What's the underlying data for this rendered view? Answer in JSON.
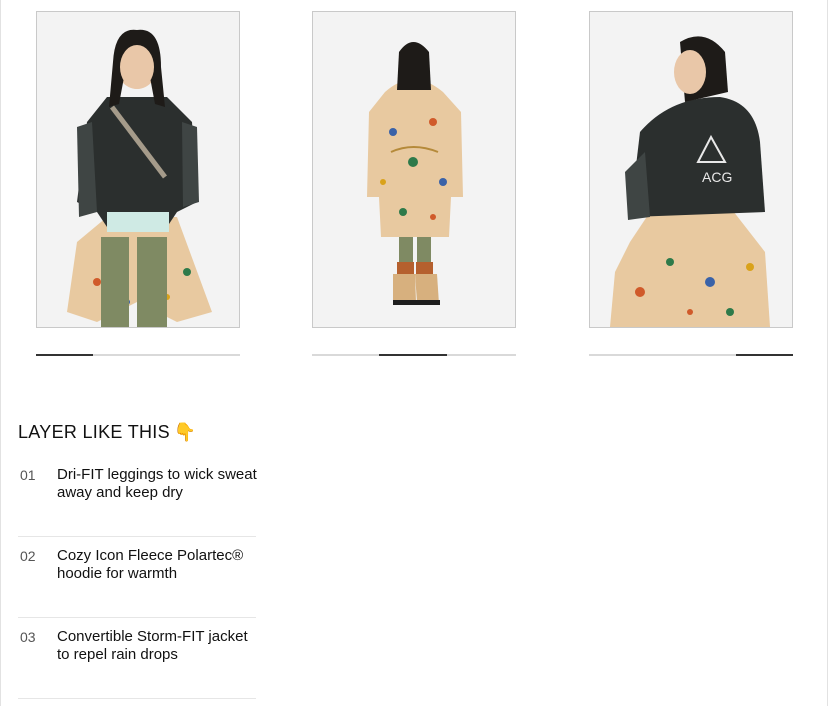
{
  "gallery": {
    "slides": [
      {
        "name": "front-view",
        "progress_fraction": 0.28,
        "progress_start": 0.0
      },
      {
        "name": "back-view",
        "progress_fraction": 0.33,
        "progress_start": 0.33
      },
      {
        "name": "side-view",
        "progress_fraction": 0.28,
        "progress_start": 0.72
      }
    ]
  },
  "layer_section": {
    "title": "LAYER LIKE THIS",
    "emoji": "👇",
    "items": [
      {
        "number": "01",
        "text": "Dri-FIT leggings to wick sweat away and keep dry"
      },
      {
        "number": "02",
        "text": "Cozy Icon Fleece Polartec® hoodie for warmth"
      },
      {
        "number": "03",
        "text": "Convertible Storm-FIT jacket to repel rain drops"
      }
    ]
  },
  "colors": {
    "fleece": "#2b2f2e",
    "legging": "#7f8a63",
    "jacket_print": "#e8c9a0",
    "progress_active": "#333333",
    "progress_track": "#d9d9d9"
  }
}
